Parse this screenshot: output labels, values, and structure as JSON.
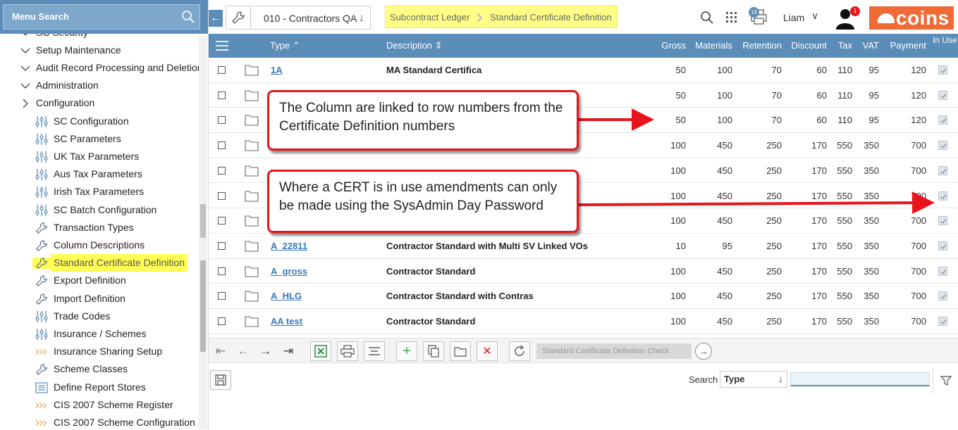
{
  "sidebar": {
    "search_label": "Menu Search",
    "items": [
      {
        "label": "SC Security",
        "kind": "chevron-down",
        "level": 0
      },
      {
        "label": "Setup Maintenance",
        "kind": "chevron-down",
        "level": 0
      },
      {
        "label": "Audit Record Processing and Deletion",
        "kind": "chevron-down",
        "level": 0
      },
      {
        "label": "Administration",
        "kind": "chevron-down",
        "level": 0
      },
      {
        "label": "Configuration",
        "kind": "chevron-right",
        "level": 0
      },
      {
        "label": "SC Configuration",
        "kind": "sliders",
        "level": 1
      },
      {
        "label": "SC Parameters",
        "kind": "sliders",
        "level": 1
      },
      {
        "label": "UK Tax Parameters",
        "kind": "sliders",
        "level": 1
      },
      {
        "label": "Aus Tax Parameters",
        "kind": "sliders",
        "level": 1
      },
      {
        "label": "Irish Tax Parameters",
        "kind": "sliders",
        "level": 1
      },
      {
        "label": "SC Batch Configuration",
        "kind": "sliders",
        "level": 1
      },
      {
        "label": "Transaction Types",
        "kind": "wrench",
        "level": 1
      },
      {
        "label": "Column Descriptions",
        "kind": "wrench",
        "level": 1
      },
      {
        "label": "Standard Certificate Definition",
        "kind": "wrench",
        "level": 1,
        "active": true
      },
      {
        "label": "Export Definition",
        "kind": "wrench",
        "level": 1
      },
      {
        "label": "Import Definition",
        "kind": "wrench",
        "level": 1
      },
      {
        "label": "Trade Codes",
        "kind": "sliders",
        "level": 1
      },
      {
        "label": "Insurance / Schemes",
        "kind": "sliders",
        "level": 1
      },
      {
        "label": "Insurance Sharing Setup",
        "kind": "chevrons",
        "level": 1
      },
      {
        "label": "Scheme Classes",
        "kind": "wrench",
        "level": 1
      },
      {
        "label": "Define Report Stores",
        "kind": "list",
        "level": 1
      },
      {
        "label": "CIS 2007 Scheme Register",
        "kind": "chevrons",
        "level": 1
      },
      {
        "label": "CIS 2007 Scheme Configuration",
        "kind": "chevrons",
        "level": 1
      }
    ]
  },
  "topbar": {
    "company": "010 - Contractors QA",
    "breadcrumbs": [
      "Subcontract Ledger",
      "Standard Certificate Definition"
    ],
    "print_badge": "19",
    "user_name": "Liam",
    "notif_badge": "1",
    "logo_text": "coins",
    "colors": {
      "accent": "#5b8db8",
      "brand": "#f06a35",
      "highlight": "#ffff88"
    }
  },
  "grid": {
    "columns": {
      "type": "Type",
      "description": "Description",
      "gross": "Gross",
      "materials": "Materials",
      "retention": "Retention",
      "discount": "Discount",
      "tax": "Tax",
      "vat": "VAT",
      "payment": "Payment",
      "in_use": "In Use?"
    },
    "rows": [
      {
        "type": "1A",
        "description": "MA Standard Certifica",
        "gross": "50",
        "materials": "100",
        "retention": "70",
        "discount": "60",
        "tax": "110",
        "vat": "95",
        "payment": "120",
        "in_use": true
      },
      {
        "type": "",
        "description": "",
        "gross": "50",
        "materials": "100",
        "retention": "70",
        "discount": "60",
        "tax": "110",
        "vat": "95",
        "payment": "120",
        "in_use": true
      },
      {
        "type": "",
        "description": "",
        "gross": "50",
        "materials": "100",
        "retention": "70",
        "discount": "60",
        "tax": "110",
        "vat": "95",
        "payment": "120",
        "in_use": true
      },
      {
        "type": "",
        "description": "",
        "gross": "100",
        "materials": "450",
        "retention": "250",
        "discount": "170",
        "tax": "550",
        "vat": "350",
        "payment": "700",
        "in_use": true
      },
      {
        "type": "",
        "description": "",
        "gross": "100",
        "materials": "450",
        "retention": "250",
        "discount": "170",
        "tax": "550",
        "vat": "350",
        "payment": "700",
        "in_use": true
      },
      {
        "type": "",
        "description": "",
        "gross": "100",
        "materials": "450",
        "retention": "250",
        "discount": "170",
        "tax": "550",
        "vat": "350",
        "payment": "700",
        "in_use": true
      },
      {
        "type": "",
        "description": "",
        "gross": "100",
        "materials": "450",
        "retention": "250",
        "discount": "170",
        "tax": "550",
        "vat": "350",
        "payment": "700",
        "in_use": true
      },
      {
        "type": "A_22811",
        "description": "Contractor Standard with Multi SV Linked VOs",
        "gross": "10",
        "materials": "95",
        "retention": "250",
        "discount": "170",
        "tax": "550",
        "vat": "350",
        "payment": "700",
        "in_use": true
      },
      {
        "type": "A_gross",
        "description": "Contractor Standard",
        "gross": "100",
        "materials": "450",
        "retention": "250",
        "discount": "170",
        "tax": "550",
        "vat": "350",
        "payment": "700",
        "in_use": true
      },
      {
        "type": "A_HLG",
        "description": "Contractor Standard with Contras",
        "gross": "100",
        "materials": "450",
        "retention": "250",
        "discount": "170",
        "tax": "550",
        "vat": "350",
        "payment": "700",
        "in_use": true
      },
      {
        "type": "AA test",
        "description": "Contractor Standard",
        "gross": "100",
        "materials": "450",
        "retention": "250",
        "discount": "170",
        "tax": "550",
        "vat": "350",
        "payment": "700",
        "in_use": true
      }
    ]
  },
  "callouts": {
    "one": "The Column are linked to row numbers from the Certificate Definition numbers",
    "two": "Where a CERT is in use amendments can only be made using the SysAdmin Day Password"
  },
  "toolbar": {
    "check_placeholder": "Standard Certificate Definition Check"
  },
  "lower": {
    "search_label": "Search",
    "search_by": "Type"
  }
}
